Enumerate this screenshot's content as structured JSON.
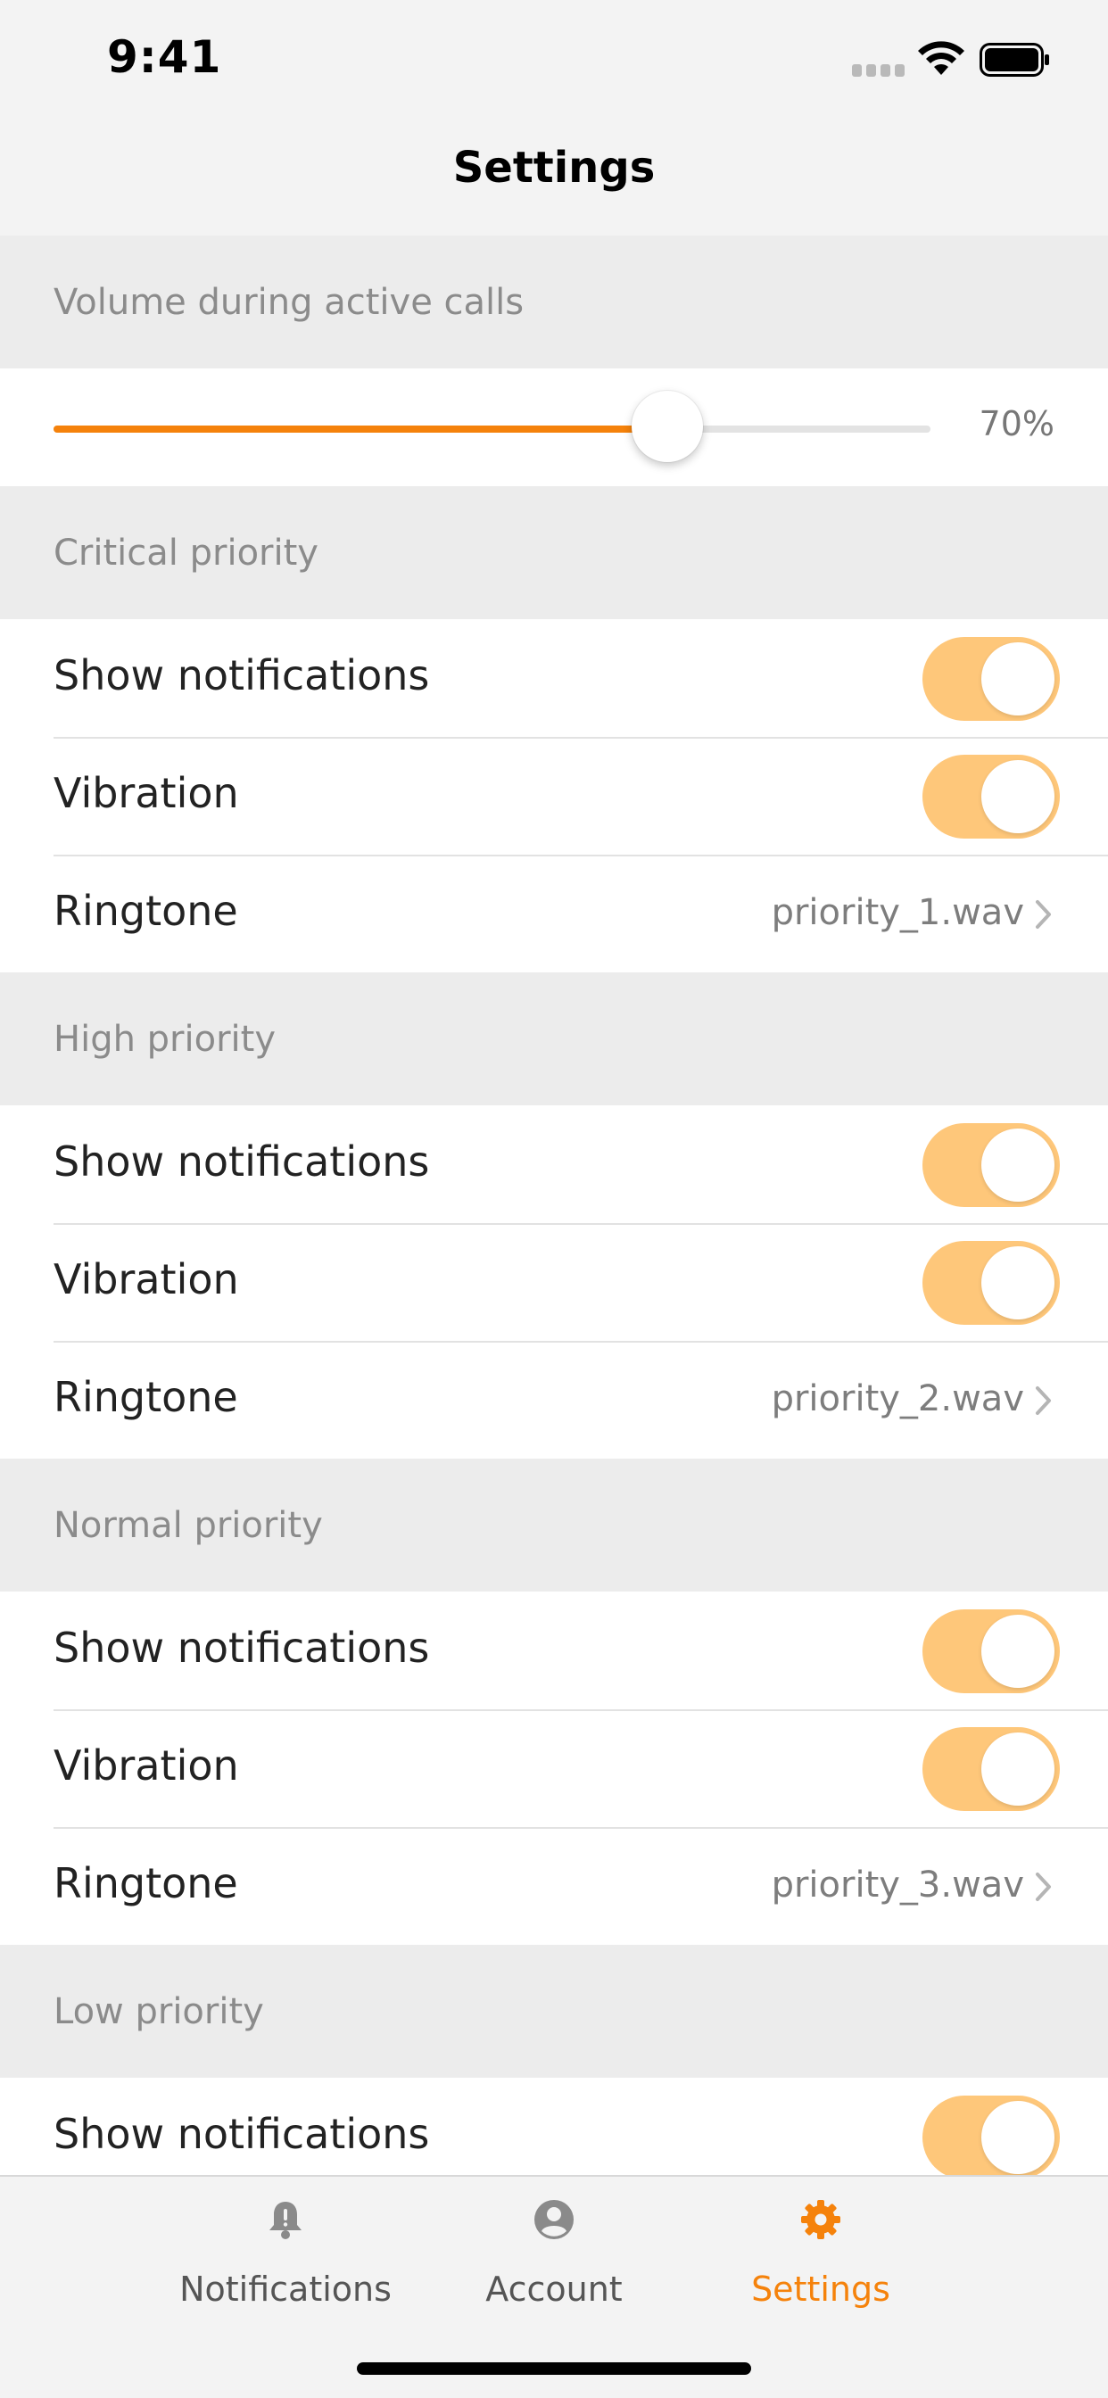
{
  "status_bar": {
    "time": "9:41"
  },
  "nav": {
    "title": "Settings"
  },
  "volume": {
    "header": "Volume during active calls",
    "level": 0.7,
    "value_label": "70%"
  },
  "sections": [
    {
      "header": "Critical priority",
      "show_notifications": {
        "label": "Show notifications",
        "on": true
      },
      "vibration": {
        "label": "Vibration",
        "on": true
      },
      "ringtone": {
        "label": "Ringtone",
        "value": "priority_1.wav"
      }
    },
    {
      "header": "High priority",
      "show_notifications": {
        "label": "Show notifications",
        "on": true
      },
      "vibration": {
        "label": "Vibration",
        "on": true
      },
      "ringtone": {
        "label": "Ringtone",
        "value": "priority_2.wav"
      }
    },
    {
      "header": "Normal priority",
      "show_notifications": {
        "label": "Show notifications",
        "on": true
      },
      "vibration": {
        "label": "Vibration",
        "on": true
      },
      "ringtone": {
        "label": "Ringtone",
        "value": "priority_3.wav"
      }
    },
    {
      "header": "Low priority",
      "show_notifications": {
        "label": "Show notifications",
        "on": true
      }
    }
  ],
  "tab_bar": {
    "tabs": [
      {
        "label": "Notifications",
        "icon": "bell-icon",
        "active": false
      },
      {
        "label": "Account",
        "icon": "account-icon",
        "active": false
      },
      {
        "label": "Settings",
        "icon": "gear-icon",
        "active": true
      }
    ]
  },
  "colors": {
    "accent": "#f5820b",
    "toggle_on": "#fec77a",
    "section_bg": "#ececec",
    "page_bg": "#f3f3f3"
  }
}
